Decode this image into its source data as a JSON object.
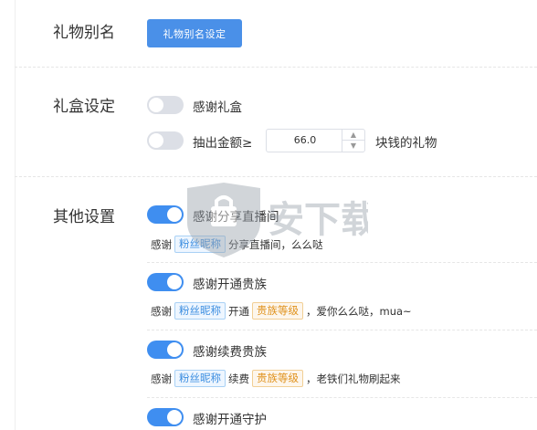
{
  "sections": {
    "alias": {
      "label": "礼物别名",
      "button_label": "礼物别名设定"
    },
    "giftbox": {
      "label": "礼盒设定",
      "options": [
        {
          "label": "感谢礼盒",
          "enabled": false
        },
        {
          "label": "抽出金额≥",
          "enabled": false
        }
      ],
      "amount_value": "66.0",
      "amount_suffix": "块钱的礼物"
    },
    "other": {
      "label": "其他设置",
      "items": [
        {
          "label": "感谢分享直播间",
          "enabled": true,
          "msg": [
            "感谢",
            "粉丝昵称",
            "分享直播间，么么哒"
          ]
        },
        {
          "label": "感谢开通贵族",
          "enabled": true,
          "msg": [
            "感谢",
            "粉丝昵称",
            "开通",
            "贵族等级",
            "，爱你么么哒，mua~"
          ]
        },
        {
          "label": "感谢续费贵族",
          "enabled": true,
          "msg": [
            "感谢",
            "粉丝昵称",
            "续费",
            "贵族等级",
            "，老铁们礼物刷起来"
          ]
        },
        {
          "label": "感谢开通守护",
          "enabled": true
        }
      ]
    }
  },
  "watermark": {
    "text": "安下载"
  },
  "colors": {
    "primary": "#4a90e8",
    "toggle_on": "#3f8ef0",
    "toggle_off": "#dcdfe6",
    "tag_blue": "#3b8de0",
    "tag_orange": "#e0921d"
  }
}
